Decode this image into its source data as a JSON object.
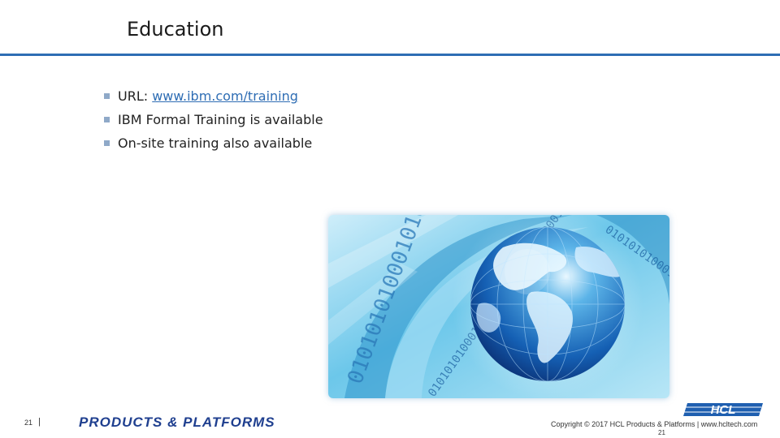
{
  "slide": {
    "title": "Education",
    "bullets": [
      {
        "prefix": "URL: ",
        "link": "www.ibm.com/training"
      },
      {
        "text": "IBM Formal Training is available"
      },
      {
        "text": "On-site training also available"
      }
    ]
  },
  "image": {
    "description": "globe with binary code background",
    "binary_text": "0101010100010101010010101010100010101"
  },
  "footer": {
    "page_number": "21",
    "separator": "|",
    "brand": "PRODUCTS & PLATFORMS",
    "copyright": "Copyright © 2017 HCL Products & Platforms | www.hcltech.com",
    "page_number_small": "21",
    "logo_text": "HCL"
  },
  "colors": {
    "rule": "#2e6db4",
    "bullet": "#8fa9c8",
    "link": "#2e6db4",
    "brand": "#1f3f8f",
    "logo": "#1f5fb0"
  }
}
